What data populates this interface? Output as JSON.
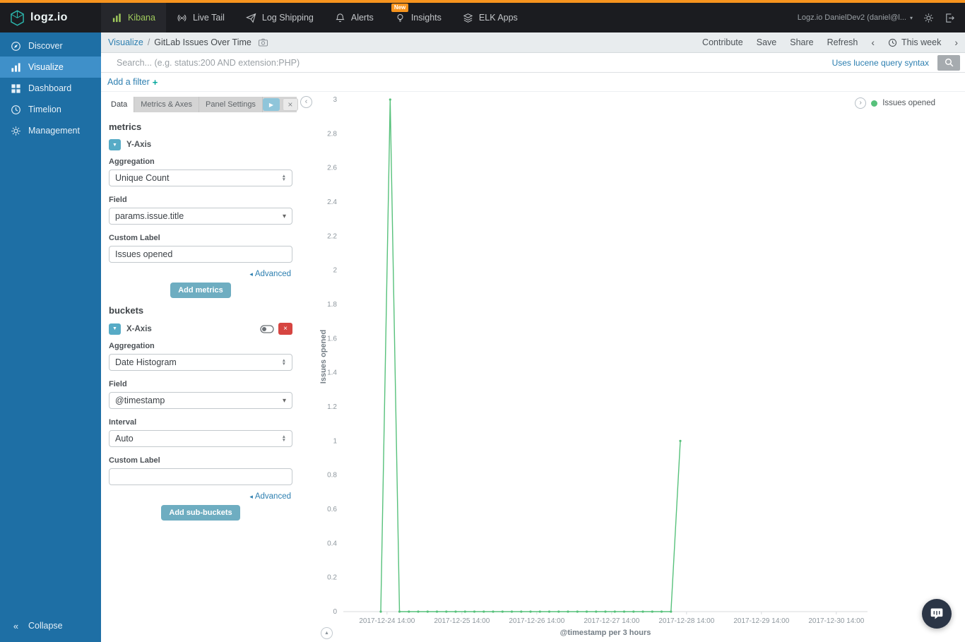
{
  "colors": {
    "accent_orange": "#f7941e",
    "sidebar_blue": "#1e6fa5",
    "sidebar_active_blue": "#3f90c9",
    "link_blue": "#2d7fb0",
    "series_green": "#57c17b",
    "danger_red": "#d64541",
    "teal_button": "#6eadc1"
  },
  "topbar": {
    "logo_text": "logz.io",
    "nav": [
      {
        "label": "Kibana"
      },
      {
        "label": "Live Tail"
      },
      {
        "label": "Log Shipping"
      },
      {
        "label": "Alerts"
      },
      {
        "label": "Insights",
        "badge": "New"
      },
      {
        "label": "ELK Apps"
      }
    ],
    "account_label": "Logz.io DanielDev2 (daniel@l..."
  },
  "sidebar": {
    "items": [
      {
        "label": "Discover"
      },
      {
        "label": "Visualize"
      },
      {
        "label": "Dashboard"
      },
      {
        "label": "Timelion"
      },
      {
        "label": "Management"
      }
    ],
    "collapse_label": "Collapse"
  },
  "breadcrumb": {
    "section": "Visualize",
    "separator": "/",
    "title": "GitLab Issues Over Time"
  },
  "toolbar": {
    "contribute": "Contribute",
    "save": "Save",
    "share": "Share",
    "refresh": "Refresh",
    "prev_arrow": "‹",
    "next_arrow": "›",
    "time_range": "This week"
  },
  "search": {
    "placeholder": "Search... (e.g. status:200 AND extension:PHP)",
    "syntax_hint": "Uses lucene query syntax"
  },
  "filters": {
    "add_filter": "Add a filter",
    "plus": "+"
  },
  "editor": {
    "tabs": [
      {
        "label": "Data"
      },
      {
        "label": "Metrics & Axes"
      },
      {
        "label": "Panel Settings"
      }
    ],
    "metrics": {
      "header": "metrics",
      "axis_label": "Y-Axis",
      "aggregation_label": "Aggregation",
      "aggregation_value": "Unique Count",
      "field_label": "Field",
      "field_value": "params.issue.title",
      "custom_label_label": "Custom Label",
      "custom_label_value": "Issues opened",
      "advanced_label": "Advanced",
      "add_button": "Add metrics"
    },
    "buckets": {
      "header": "buckets",
      "axis_label": "X-Axis",
      "aggregation_label": "Aggregation",
      "aggregation_value": "Date Histogram",
      "field_label": "Field",
      "field_value": "@timestamp",
      "interval_label": "Interval",
      "interval_value": "Auto",
      "custom_label_label": "Custom Label",
      "custom_label_value": "",
      "advanced_label": "Advanced",
      "add_button": "Add sub-buckets"
    }
  },
  "chart_data": {
    "type": "line",
    "title": "",
    "ylabel": "Issues opened",
    "xlabel": "@timestamp per 3 hours",
    "ylim": [
      0,
      3
    ],
    "grid": false,
    "y_ticks": [
      "3",
      "2.8",
      "2.6",
      "2.4",
      "2.2",
      "2",
      "1.8",
      "1.6",
      "1.4",
      "1.2",
      "1",
      "0.8",
      "0.6",
      "0.4",
      "0.2",
      "0"
    ],
    "x_domain": {
      "start": "2017-12-24 00:00",
      "hours": 168
    },
    "x_ticks": [
      {
        "hour": 14,
        "label": "2017-12-24 14:00"
      },
      {
        "hour": 38,
        "label": "2017-12-25 14:00"
      },
      {
        "hour": 62,
        "label": "2017-12-26 14:00"
      },
      {
        "hour": 86,
        "label": "2017-12-27 14:00"
      },
      {
        "hour": 110,
        "label": "2017-12-28 14:00"
      },
      {
        "hour": 134,
        "label": "2017-12-29 14:00"
      },
      {
        "hour": 158,
        "label": "2017-12-30 14:00"
      }
    ],
    "legend": {
      "label": "Issues opened",
      "color": "#57c17b",
      "position": "top-right"
    },
    "series": [
      {
        "name": "Issues opened",
        "color": "#57c17b",
        "start_offset_hours": 12,
        "interval_hours": 3,
        "values": [
          0,
          3,
          0,
          0,
          0,
          0,
          0,
          0,
          0,
          0,
          0,
          0,
          0,
          0,
          0,
          0,
          0,
          0,
          0,
          0,
          0,
          0,
          0,
          0,
          0,
          0,
          0,
          0,
          0,
          0,
          0,
          0,
          1
        ]
      }
    ]
  }
}
